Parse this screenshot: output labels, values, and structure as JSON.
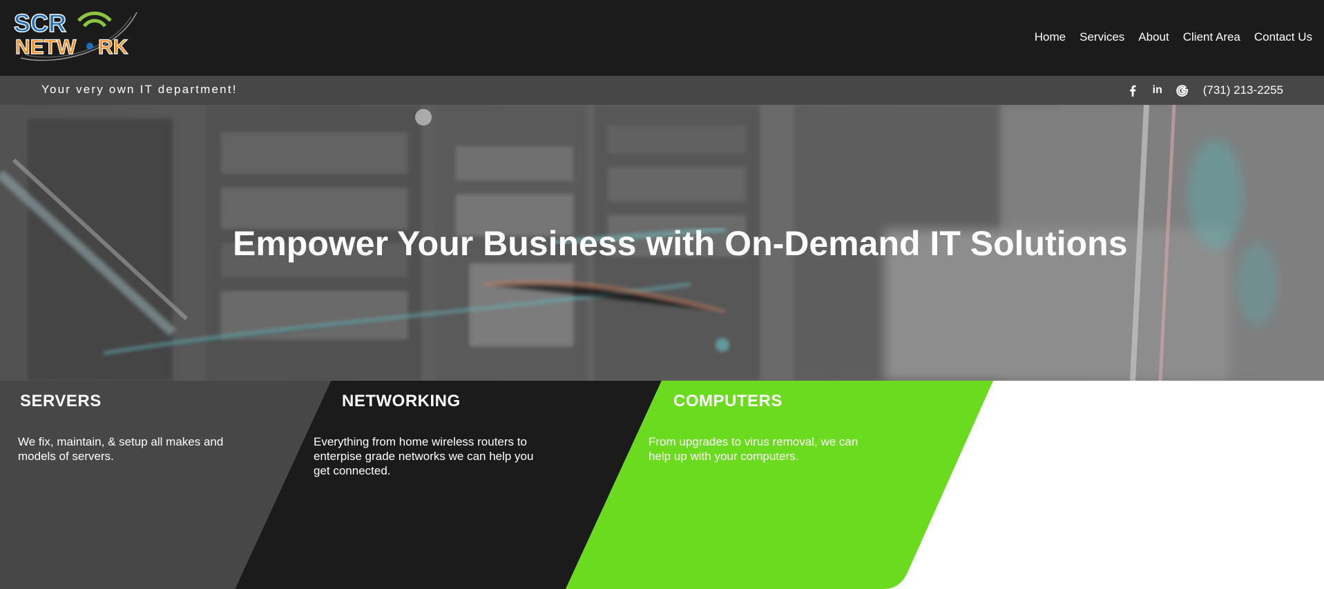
{
  "brand": {
    "logo_line1": "SCR",
    "logo_line2": "NETWORK",
    "colors": {
      "blue": "#1e6fb8",
      "orange": "#f58a1f",
      "green": "#8cc63f"
    }
  },
  "nav": {
    "items": [
      {
        "label": "Home"
      },
      {
        "label": "Services"
      },
      {
        "label": "About"
      },
      {
        "label": "Client Area"
      },
      {
        "label": "Contact Us"
      }
    ]
  },
  "topbar": {
    "tagline": "Your very own IT department!",
    "social": [
      {
        "icon": "facebook-icon",
        "glyph": "f"
      },
      {
        "icon": "linkedin-icon",
        "glyph": "in"
      },
      {
        "icon": "google-icon",
        "glyph": "G"
      }
    ],
    "phone": "(731) 213-2255"
  },
  "hero": {
    "title": "Empower Your Business with On-Demand IT Solutions"
  },
  "services": [
    {
      "title": "SERVERS",
      "text_lines": [
        "We fix, maintain, & setup all makes and",
        "models of servers."
      ],
      "color": "#474747"
    },
    {
      "title": "NETWORKING",
      "text_lines": [
        "Everything from home wireless routers to",
        "enterpise grade networks we can help you",
        "get connected."
      ],
      "color": "#1b1b1b"
    },
    {
      "title": "COMPUTERS",
      "text_lines": [
        "From upgrades to virus removal, we can",
        "help up with your computers."
      ],
      "color": "#6bdb1f"
    }
  ],
  "colors": {
    "header_bg": "#1b1b1b",
    "topbar_bg": "#474747",
    "accent_green": "#6bdb1f"
  }
}
